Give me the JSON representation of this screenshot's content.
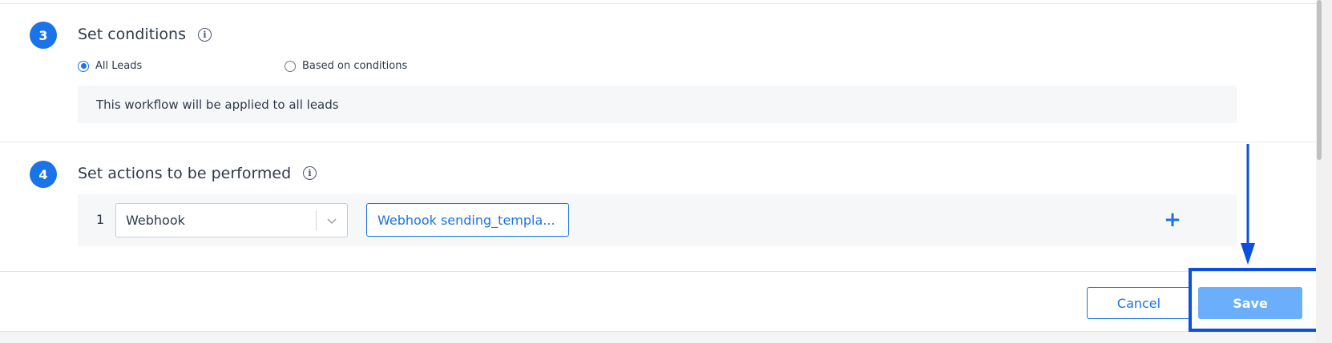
{
  "conditions": {
    "step": "3",
    "title": "Set conditions",
    "info_glyph": "i",
    "radio_all_label": "All Leads",
    "radio_conditions_label": "Based on conditions",
    "selected": "all",
    "message": "This workflow will be applied to all leads"
  },
  "actions": {
    "step": "4",
    "title": "Set actions to be performed",
    "info_glyph": "i",
    "rows": [
      {
        "number": "1",
        "action_type": "Webhook",
        "template_label": "Webhook sending_templa...",
        "add_glyph": "+"
      }
    ]
  },
  "footer": {
    "cancel_label": "Cancel",
    "save_label": "Save"
  },
  "colors": {
    "accent": "#1a73e8",
    "save_button": "#6aaefc",
    "annotation": "#0a4fe0"
  },
  "icons": {
    "info": "info-circle-icon",
    "chevron": "chevron-down-icon",
    "add": "plus-icon",
    "arrow": "arrow-down-icon"
  }
}
